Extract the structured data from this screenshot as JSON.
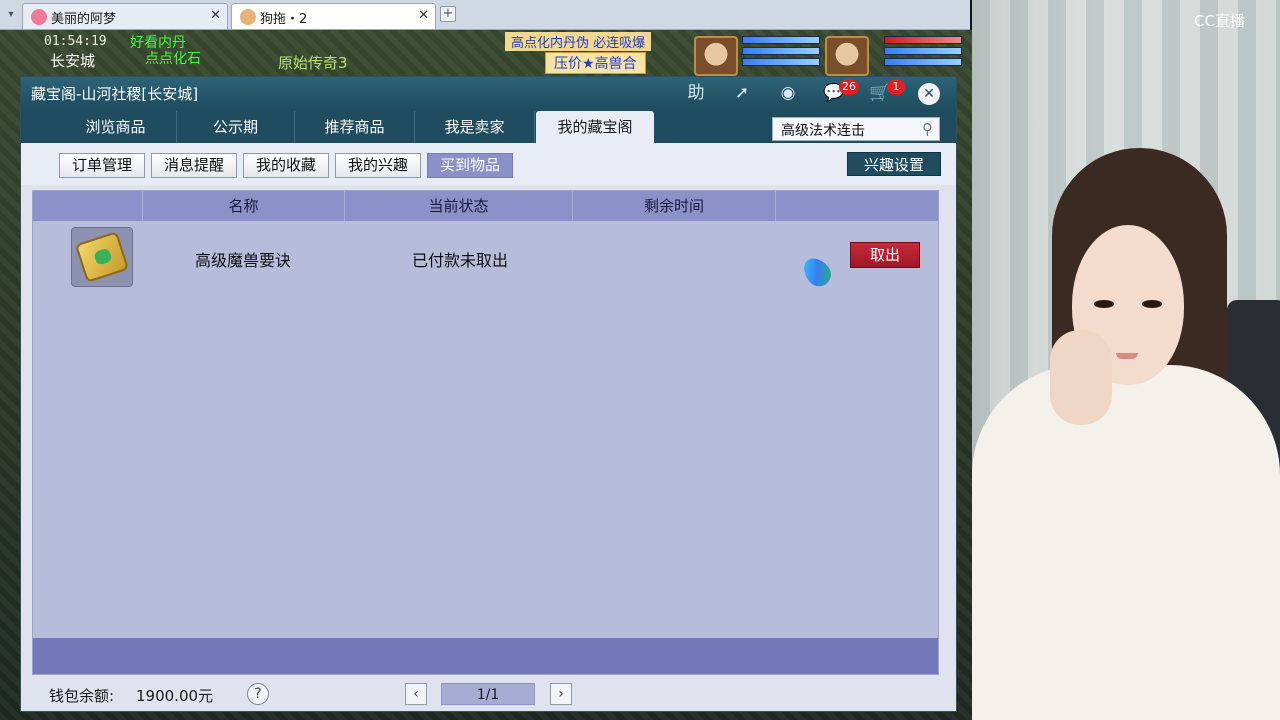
{
  "browser": {
    "tabs": [
      {
        "title": "美丽的阿梦",
        "active": false
      },
      {
        "title": "狗拖・2",
        "active": true
      }
    ]
  },
  "game_hud": {
    "time": "01:54:19",
    "city": "长安城",
    "map_name": "原始传奇3",
    "green_text_1": "好看内丹",
    "green_text_2": "点点化石",
    "banner_1": "高点化内丹伪 必连吸爆",
    "banner_2": "压价★高兽合"
  },
  "window": {
    "title": "藏宝阁-山河社稷[长安城]",
    "toolbar": {
      "help_label": "助",
      "messages_count": "26",
      "cart_count": "1"
    },
    "nav_tabs": [
      {
        "label": "浏览商品",
        "active": false
      },
      {
        "label": "公示期",
        "active": false
      },
      {
        "label": "推荐商品",
        "active": false
      },
      {
        "label": "我是卖家",
        "active": false
      },
      {
        "label": "我的藏宝阁",
        "active": true
      }
    ],
    "search": {
      "value": "高级法术连击"
    },
    "sub_tabs": [
      {
        "label": "订单管理",
        "active": false
      },
      {
        "label": "消息提醒",
        "active": false
      },
      {
        "label": "我的收藏",
        "active": false
      },
      {
        "label": "我的兴趣",
        "active": false
      },
      {
        "label": "买到物品",
        "active": true
      }
    ],
    "interest_settings_label": "兴趣设置",
    "table": {
      "headers": [
        "名称",
        "当前状态",
        "剩余时间"
      ],
      "rows": [
        {
          "name": "高级魔兽要诀",
          "status": "已付款未取出",
          "remaining": "",
          "action": "取出"
        }
      ]
    },
    "footer": {
      "balance_label": "钱包余额:",
      "balance_value": "1900.00元",
      "page": "1/1"
    }
  },
  "webcam": {
    "logo": "CC直播"
  },
  "colors": {
    "title_bar": "#1f4c5f",
    "table_bg": "#b8bcdb",
    "table_header": "#8c91c9",
    "action_button": "#b01e2e",
    "active_subtab": "#8b90c8"
  }
}
